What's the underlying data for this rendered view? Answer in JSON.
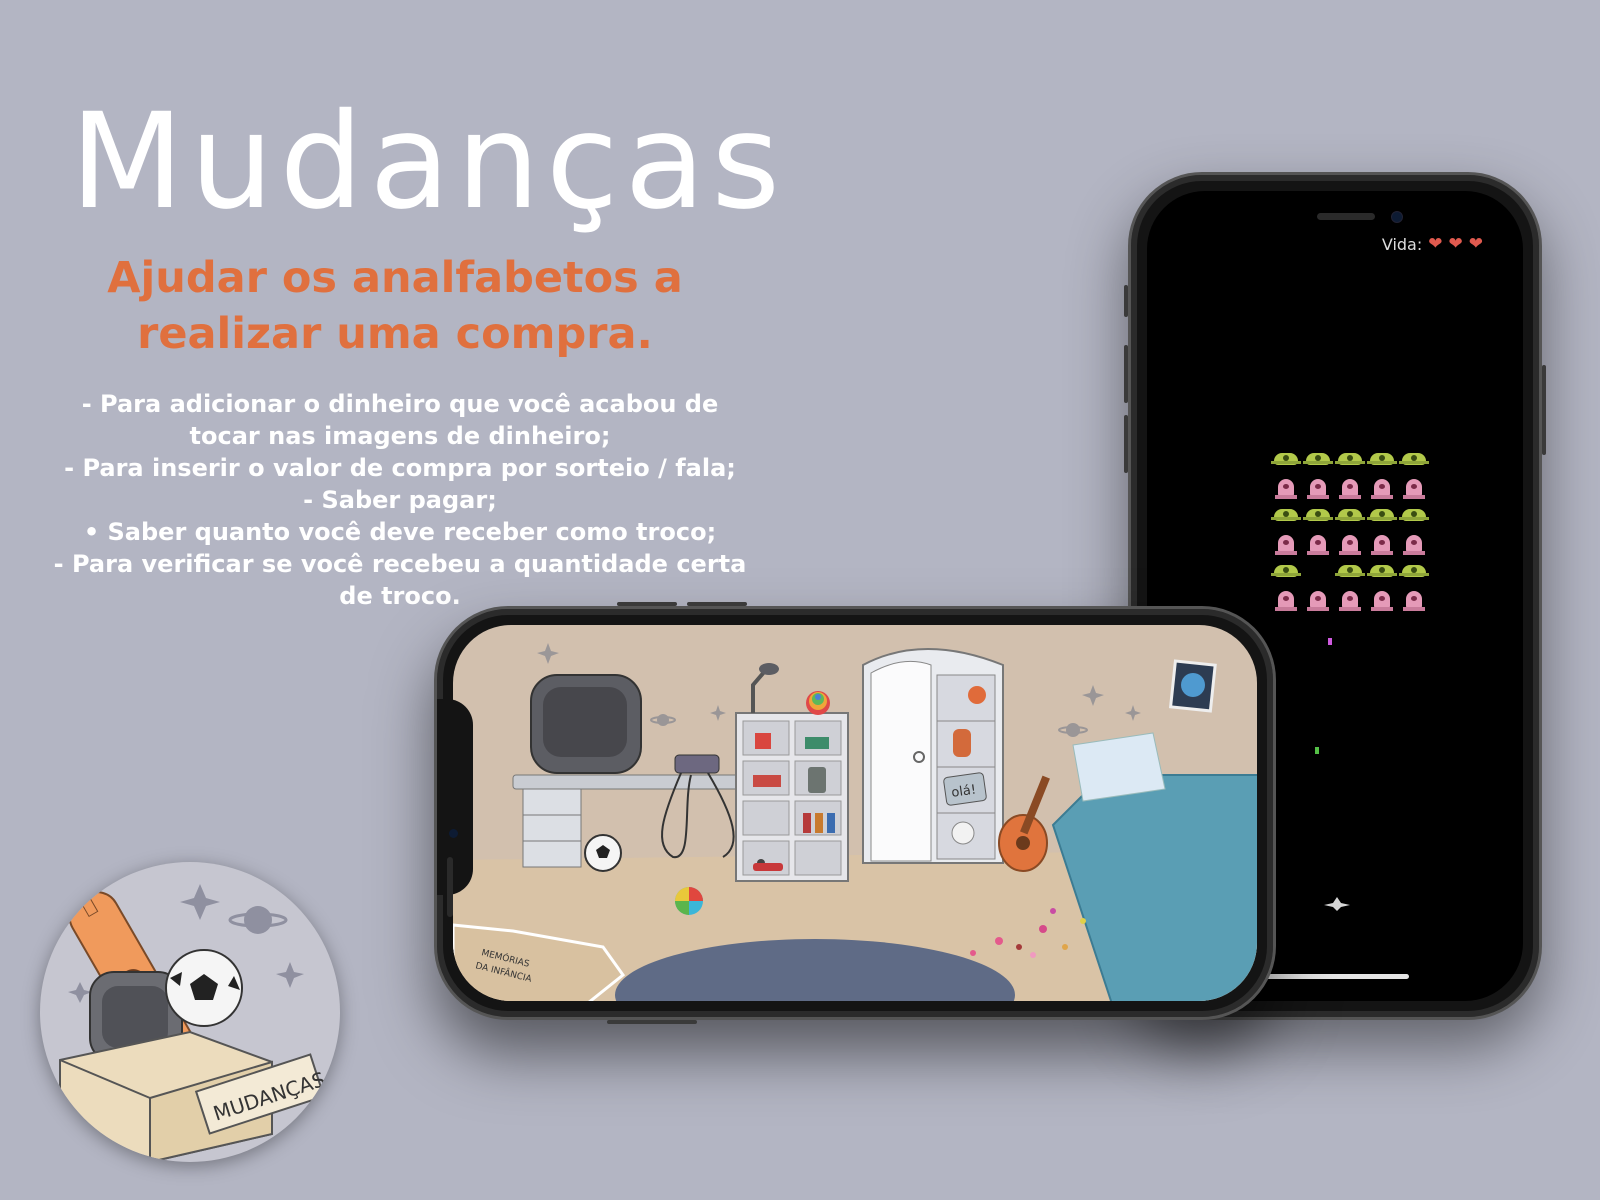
{
  "title": "Mudanças",
  "subtitle": [
    "Ajudar os analfabetos a",
    "realizar uma compra."
  ],
  "features": [
    "- Para adicionar o dinheiro que você acabou de",
    "tocar nas imagens de dinheiro;",
    "- Para inserir o valor de compra por sorteio / fala;",
    "- Saber pagar;",
    "• Saber quanto você deve receber como troco;",
    "- Para verificar se você recebeu a quantidade certa",
    "de troco."
  ],
  "game": {
    "lives_label": "Vida:",
    "lives": 3,
    "heart_glyph": "❤"
  },
  "room": {
    "box_label_line1": "MEMÓRIAS",
    "box_label_line2": "DA INFÂNCIA",
    "sign_text": "olá!"
  },
  "logo": {
    "box_label": "MUDANÇAS"
  },
  "colors": {
    "background": "#b3b5c3",
    "accent": "#e0703e",
    "heart": "#e05a4f"
  }
}
